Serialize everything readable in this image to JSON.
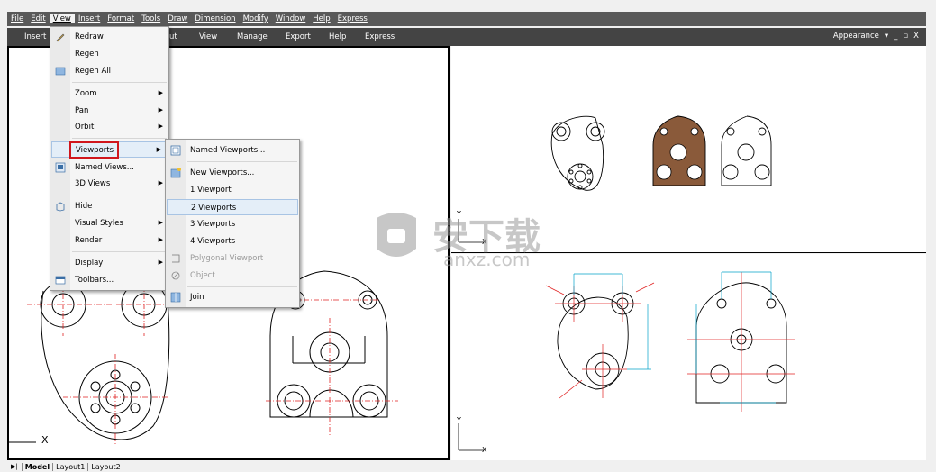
{
  "menubar": {
    "items": [
      "File",
      "Edit",
      "View",
      "Insert",
      "Format",
      "Tools",
      "Draw",
      "Dimension",
      "Modify",
      "Window",
      "Help",
      "Express"
    ],
    "active": "View"
  },
  "ribbon": {
    "tabs": [
      "Insert",
      "ut",
      "View",
      "Manage",
      "Export",
      "Help",
      "Express"
    ],
    "workspace": "Appearance",
    "window_controls": [
      "▾",
      "_",
      "▫",
      "X"
    ]
  },
  "view_menu": {
    "items": [
      {
        "label": "Redraw",
        "icon": "pencil-icon"
      },
      {
        "label": "Regen",
        "icon": ""
      },
      {
        "label": "Regen All",
        "icon": "regen-all-icon"
      },
      {
        "label": "Zoom",
        "submenu": true
      },
      {
        "label": "Pan",
        "submenu": true
      },
      {
        "label": "Orbit",
        "submenu": true
      },
      {
        "label": "Viewports",
        "submenu": true
      },
      {
        "label": "Named Views...",
        "icon": "named-views-icon"
      },
      {
        "label": "3D Views",
        "submenu": true
      },
      {
        "label": "Hide",
        "icon": "hide-icon"
      },
      {
        "label": "Visual Styles",
        "submenu": true
      },
      {
        "label": "Render",
        "submenu": true
      },
      {
        "label": "Display",
        "submenu": true
      },
      {
        "label": "Toolbars...",
        "icon": "toolbars-icon"
      }
    ]
  },
  "viewports_submenu": {
    "items": [
      {
        "label": "Named Viewports...",
        "icon": "named-viewports-icon",
        "disabled": false
      },
      {
        "label": "New Viewports...",
        "icon": "new-viewports-icon",
        "disabled": false
      },
      {
        "label": "1 Viewport",
        "disabled": false
      },
      {
        "label": "2 Viewports",
        "disabled": false,
        "highlighted": true
      },
      {
        "label": "3 Viewports",
        "disabled": false
      },
      {
        "label": "4 Viewports",
        "disabled": false
      },
      {
        "label": "Polygonal Viewport",
        "icon": "polygonal-viewport-icon",
        "disabled": true
      },
      {
        "label": "Object",
        "icon": "object-icon",
        "disabled": true
      },
      {
        "label": "Join",
        "icon": "join-icon",
        "disabled": false
      }
    ]
  },
  "layout_tabs": [
    "Model",
    "Layout1",
    "Layout2"
  ],
  "axes": {
    "x": "X",
    "y": "Y"
  },
  "watermark": {
    "text": "安下载",
    "sub": "anxz.com"
  },
  "colors": {
    "menubar": "#595959",
    "ribbon": "#444444",
    "highlight_box": "#d0161d",
    "centerline": "#e02020",
    "dimension": "#00a0c8",
    "shaded_part": "#8a5a3a"
  }
}
